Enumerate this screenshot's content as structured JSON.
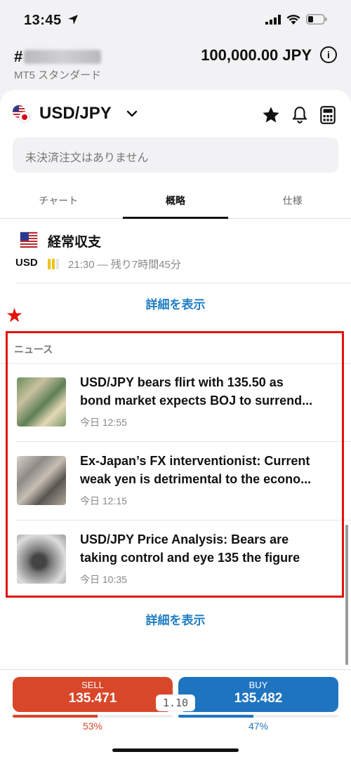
{
  "status_bar": {
    "time": "13:45"
  },
  "account": {
    "number_prefix": "#",
    "type": "MT5 スタンダード",
    "balance": "100,000.00 JPY",
    "info_glyph": "i"
  },
  "symbol": {
    "name": "USD/JPY"
  },
  "orders": {
    "empty_text": "未決済注文はありません"
  },
  "tabs": [
    {
      "label": "チャート",
      "active": false
    },
    {
      "label": "概略",
      "active": true
    },
    {
      "label": "仕様",
      "active": false
    }
  ],
  "event": {
    "title": "経常収支",
    "currency": "USD",
    "time_text": "21:30 — 残り7時間45分",
    "impact_level": 2,
    "impact_max": 3
  },
  "links": {
    "show_details": "詳細を表示"
  },
  "news": {
    "header": "ニュース",
    "items": [
      {
        "line1": "USD/JPY bears flirt with 135.50 as",
        "line2": "bond market expects BOJ to surrend...",
        "time": "今日 12:55"
      },
      {
        "line1": "Ex-Japan’s FX interventionist: Current",
        "line2": "weak yen is detrimental to the econo...",
        "time": "今日 12:15"
      },
      {
        "line1": "USD/JPY Price Analysis: Bears are",
        "line2": "taking control and eye 135 the figure",
        "time": "今日 10:35"
      }
    ]
  },
  "annotation": {
    "star": "★"
  },
  "trade": {
    "sell_label": "SELL",
    "sell_price": "135.471",
    "buy_label": "BUY",
    "buy_price": "135.482",
    "spread": "1.10",
    "sell_percent": "53%",
    "buy_percent": "47%",
    "sell_fraction": 0.53,
    "buy_fraction": 0.47
  },
  "colors": {
    "sell": "#d9472b",
    "buy": "#1f74c0",
    "link": "#1f7dc4",
    "highlight": "#e3120b"
  }
}
